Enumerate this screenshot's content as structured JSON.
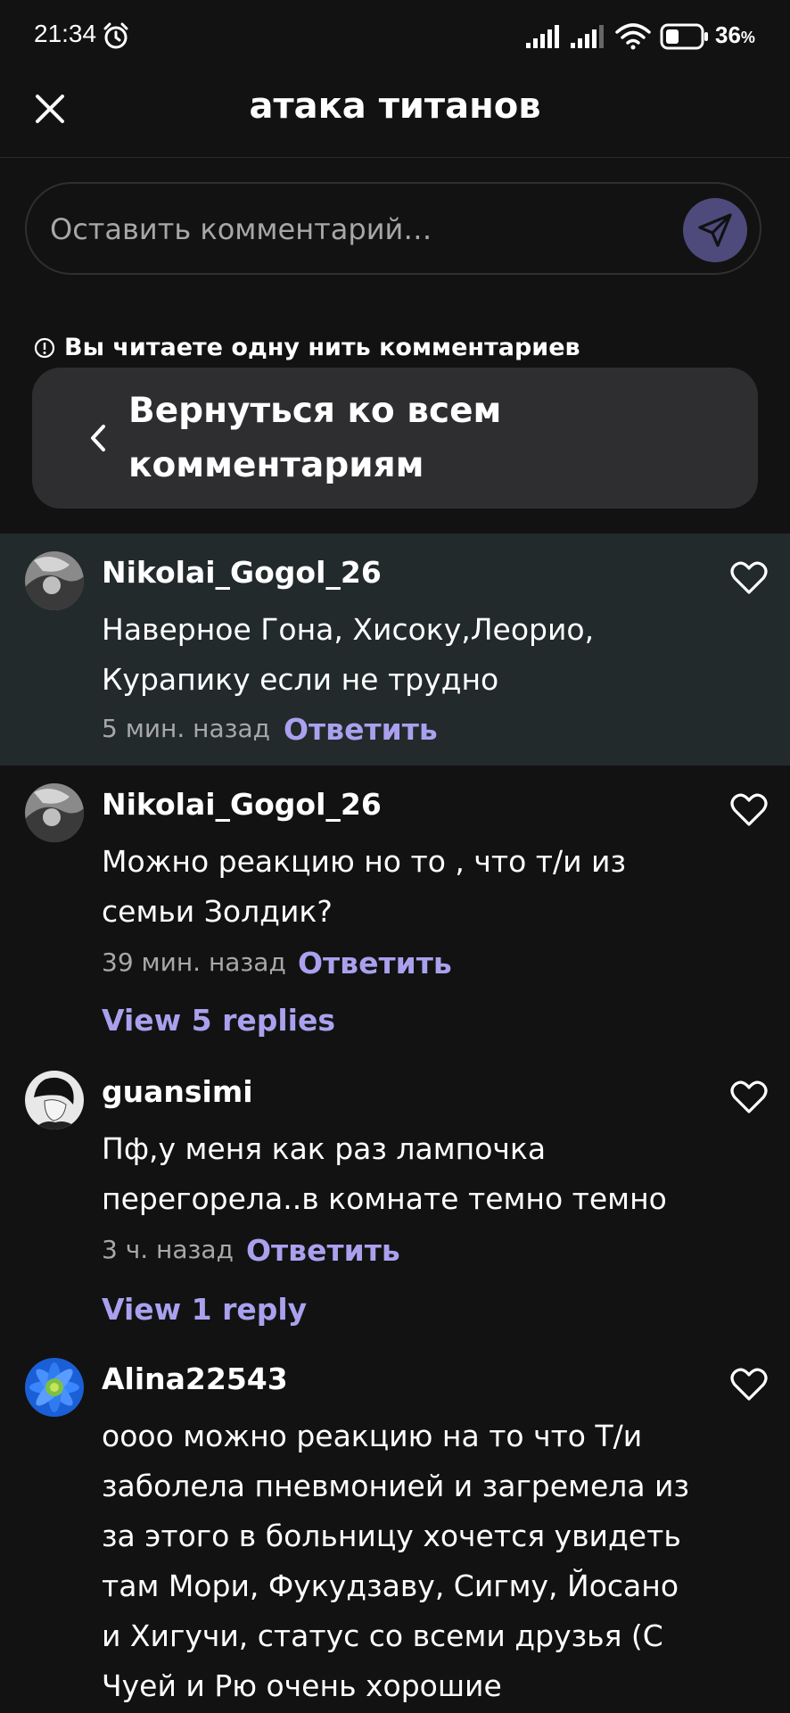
{
  "status_bar": {
    "time": "21:34",
    "battery_level": "36",
    "battery_unit": "%"
  },
  "header": {
    "title": "атака титанов",
    "close_icon": "close-icon"
  },
  "comment_input": {
    "placeholder": "Оставить комментарий…",
    "send_icon": "send-icon",
    "send_color": "#4e4a7c"
  },
  "thread_notice": {
    "text": "Вы читаете одну нить комментариев"
  },
  "back_button": {
    "label": "Вернуться ко всем комментариям"
  },
  "accent_color": "#a9a1ee",
  "comments": [
    {
      "username": "Nikolai_Gogol_26",
      "text": "Наверное Гона, Хисоку,Леорио, Курапику если не трудно",
      "time": "5 мин. назад",
      "reply_label": "Ответить",
      "highlighted": true
    },
    {
      "username": "Nikolai_Gogol_26",
      "text": "Можно реакцию но то , что т/и из семьи Золдик?",
      "time": "39 мин. назад",
      "reply_label": "Ответить",
      "view_replies": "View 5 replies"
    },
    {
      "username": "guansimi",
      "text": "Пф,у меня как раз лампочка перегорела..в комнате темно темно",
      "time": "3 ч. назад",
      "reply_label": "Ответить",
      "view_replies": "View 1 reply"
    },
    {
      "username": "Alina22543",
      "text": "оооо можно реакцию на то что Т/и заболела пневмонией и загремела из за этого в больницу хочется увидеть там Мори, Фукудзаву, Сигму, Йосано и Хигучи, статус со всеми друзья (С Чуей и Рю очень хорошие"
    }
  ]
}
